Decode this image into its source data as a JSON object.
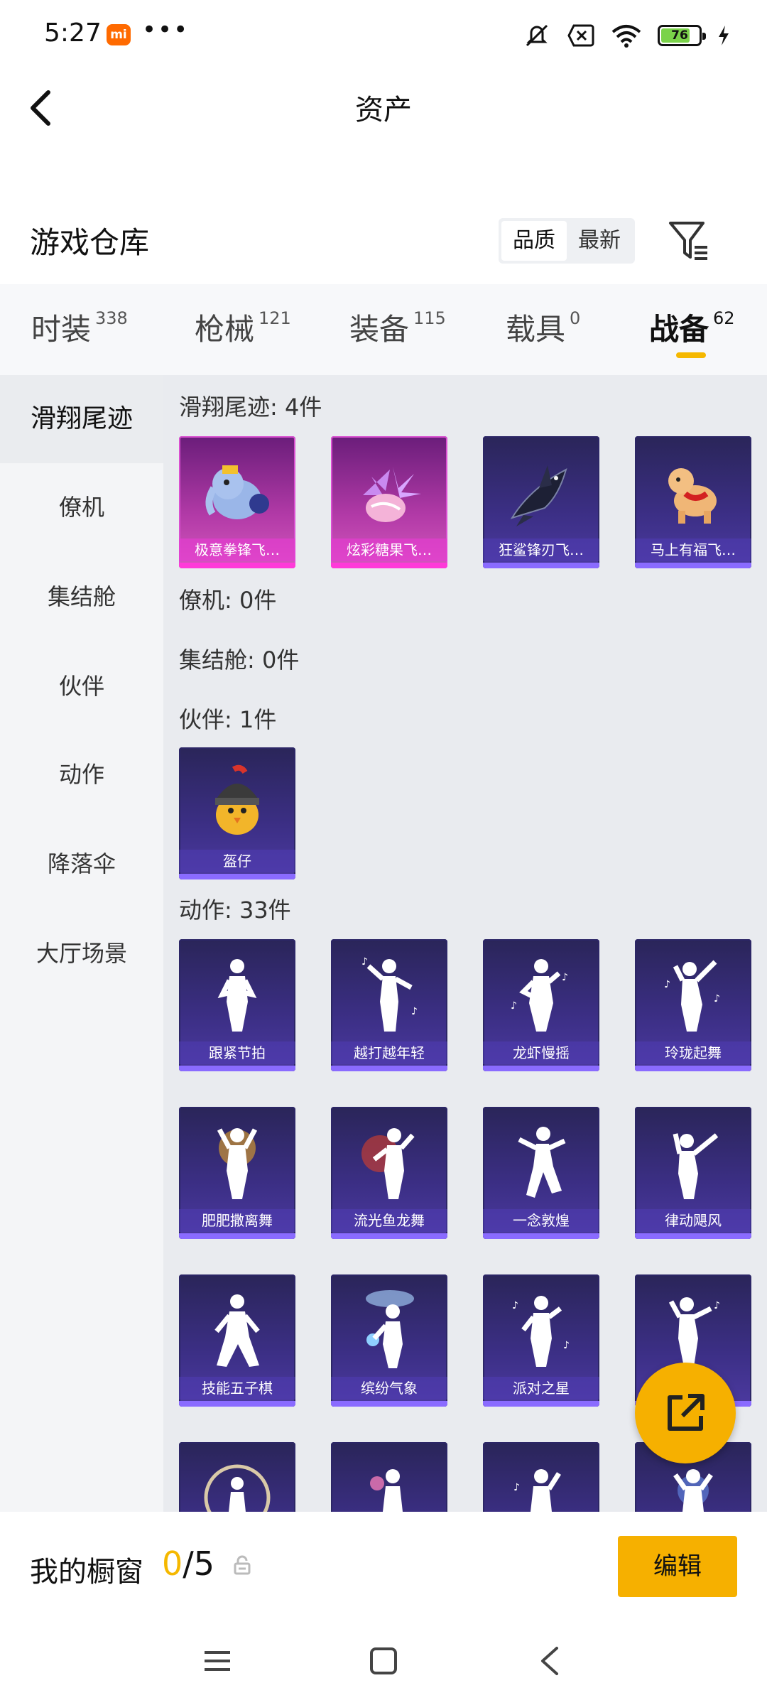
{
  "status_bar": {
    "time": "5:27",
    "mi_badge": "mi",
    "battery": "76"
  },
  "header": {
    "title": "资产"
  },
  "warehouse": {
    "title": "游戏仓库",
    "sort_options": [
      "品质",
      "最新"
    ],
    "active_sort": "品质"
  },
  "tabs": [
    {
      "label": "时装",
      "count": "338"
    },
    {
      "label": "枪械",
      "count": "121"
    },
    {
      "label": "装备",
      "count": "115"
    },
    {
      "label": "载具",
      "count": "0"
    },
    {
      "label": "战备",
      "count": "62"
    }
  ],
  "sidebar": {
    "items": [
      "滑翔尾迹",
      "僚机",
      "集结舱",
      "伙伴",
      "动作",
      "降落伞",
      "大厅场景"
    ]
  },
  "sections": {
    "trail": {
      "title": "滑翔尾迹: 4件",
      "items": [
        "极意拳锋飞…",
        "炫彩糖果飞…",
        "狂鲨锋刃飞…",
        "马上有福飞…"
      ]
    },
    "wingman": {
      "title": "僚机: 0件"
    },
    "pod": {
      "title": "集结舱: 0件"
    },
    "partner": {
      "title": "伙伴: 1件",
      "items": [
        "盔仔"
      ]
    },
    "emote": {
      "title": "动作: 33件",
      "items": [
        "跟紧节拍",
        "越打越年轻",
        "龙虾慢摇",
        "玲珑起舞",
        "肥肥撒离舞",
        "流光鱼龙舞",
        "一念敦煌",
        "律动飓风",
        "技能五子棋",
        "缤纷气象",
        "派对之星"
      ]
    }
  },
  "bottom": {
    "showcase_label": "我的橱窗",
    "showcase_current": "0",
    "showcase_sep": "/",
    "showcase_total": "5",
    "edit_label": "编辑"
  },
  "colors": {
    "accent": "#f6b000",
    "card_purple": "#3c2f86",
    "card_pink": "#d458bd"
  }
}
